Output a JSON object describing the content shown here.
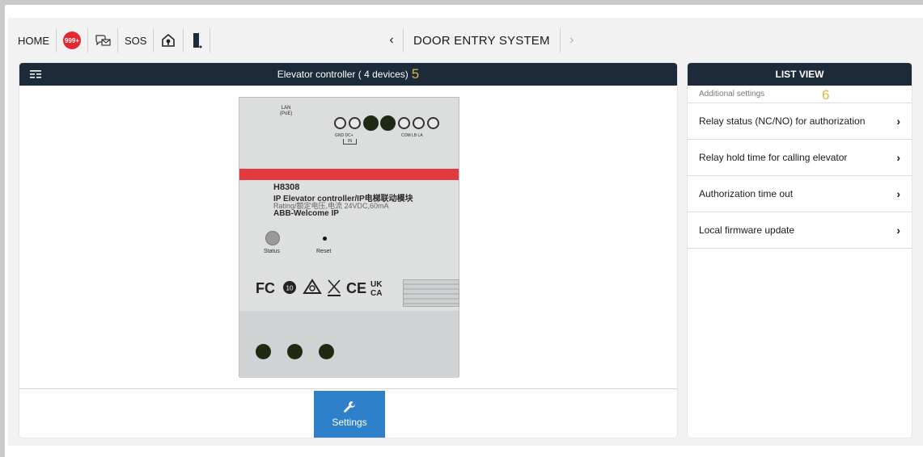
{
  "nav": {
    "home_label": "HOME",
    "alarm_badge": "999+",
    "sos_label": "SOS",
    "title": "DOOR ENTRY SYSTEM",
    "prev_icon": "chevron-left-icon",
    "next_icon": "chevron-right-icon"
  },
  "main": {
    "header_title": "Elevator controller ( 4 devices)",
    "step_number": "5",
    "settings_label": "Settings"
  },
  "device": {
    "lan_label": "LAN\n(PoE)",
    "terminal_labels_left": "GND  DC+",
    "terminal_in": "IN",
    "terminal_labels_right": "COM  LB   LA",
    "model": "H8308",
    "name_line": "IP Elevator controller/IP电梯联动模块",
    "rating_line": "Rating/额定电压,电流 24VDC,60mA",
    "brand_line": "ABB-Welcome IP",
    "status_label": "Status",
    "reset_label": "Reset"
  },
  "side": {
    "header": "LIST VIEW",
    "sub_header": "Additional settings",
    "step_number": "6",
    "items": [
      {
        "label": "Relay status (NC/NO) for authorization"
      },
      {
        "label": "Relay hold time for calling elevator"
      },
      {
        "label": "Authorization time out"
      },
      {
        "label": "Local firmware update"
      }
    ]
  },
  "colors": {
    "header_bg": "#1c2a3a",
    "accent_blue": "#2d80c9",
    "step_gold": "#e0b63c",
    "alarm_red": "#e3262f"
  }
}
